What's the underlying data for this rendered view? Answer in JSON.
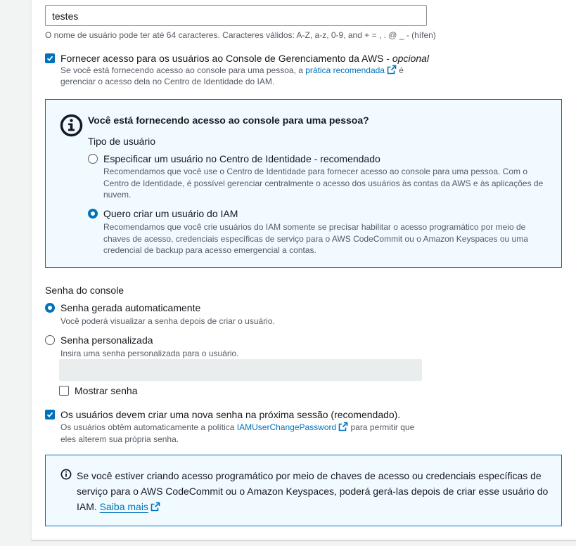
{
  "username": {
    "value": "testes",
    "hint": "O nome de usuário pode ter até 64 caracteres. Caracteres válidos: A-Z, a-z, 0-9, and + = , . @ _ - (hífen)"
  },
  "console_access": {
    "label": "Fornecer acesso para os usuários ao Console de Gerenciamento da AWS - ",
    "label_optional": "opcional",
    "desc_before": "Se você está fornecendo acesso ao console para uma pessoa, a ",
    "desc_link": "prática recomendada",
    "desc_after": " é",
    "desc_line2": "gerenciar o acesso dela no Centro de Identidade do IAM.",
    "checked": true
  },
  "user_type_box": {
    "title": "Você está fornecendo acesso ao console para uma pessoa?",
    "type_label": "Tipo de usuário",
    "options": [
      {
        "label": "Especificar um usuário no Centro de Identidade - recomendado",
        "desc_lines": [
          "Recomendamos que você use o Centro de Identidade para fornecer acesso ao console para uma pessoa. Com o",
          "Centro de Identidade, é possível gerenciar centralmente o acesso dos usuários às contas da AWS e às aplicações de",
          "nuvem."
        ],
        "selected": false
      },
      {
        "label": "Quero criar um usuário do IAM",
        "desc_lines": [
          "Recomendamos que você crie usuários do IAM somente se precisar habilitar o acesso programático por meio de",
          "chaves de acesso, credenciais específicas de serviço para o AWS CodeCommit ou o Amazon Keyspaces ou uma",
          "credencial de backup para acesso emergencial a contas."
        ],
        "selected": true
      }
    ]
  },
  "console_password": {
    "heading": "Senha do console",
    "auto": {
      "label": "Senha gerada automaticamente",
      "desc": "Você poderá visualizar a senha depois de criar o usuário.",
      "selected": true
    },
    "custom": {
      "label": "Senha personalizada",
      "desc": "Insira uma senha personalizada para o usuário.",
      "selected": false,
      "value": ""
    },
    "show_password": {
      "label": "Mostrar senha",
      "checked": false
    }
  },
  "reset_password": {
    "label": "Os usuários devem criar uma nova senha na próxima sessão (recomendado).",
    "desc_before": "Os usuários obtêm automaticamente a política ",
    "desc_link": "IAMUserChangePassword",
    "desc_after": " para permitir que",
    "desc_line2": "eles alterem sua própria senha.",
    "checked": true
  },
  "programmatic_info": {
    "line1": "Se você estiver criando acesso programático por meio de chaves de acesso ou credenciais específicas de",
    "line2": "serviço para o AWS CodeCommit ou o Amazon Keyspaces, poderá gerá-las depois de criar esse usuário do",
    "line3_before": "IAM. ",
    "link": "Saiba mais"
  },
  "colors": {
    "accent": "#0073bb",
    "info_bg": "#f1faff",
    "text": "#16191f",
    "secondary_text": "#545b64"
  }
}
